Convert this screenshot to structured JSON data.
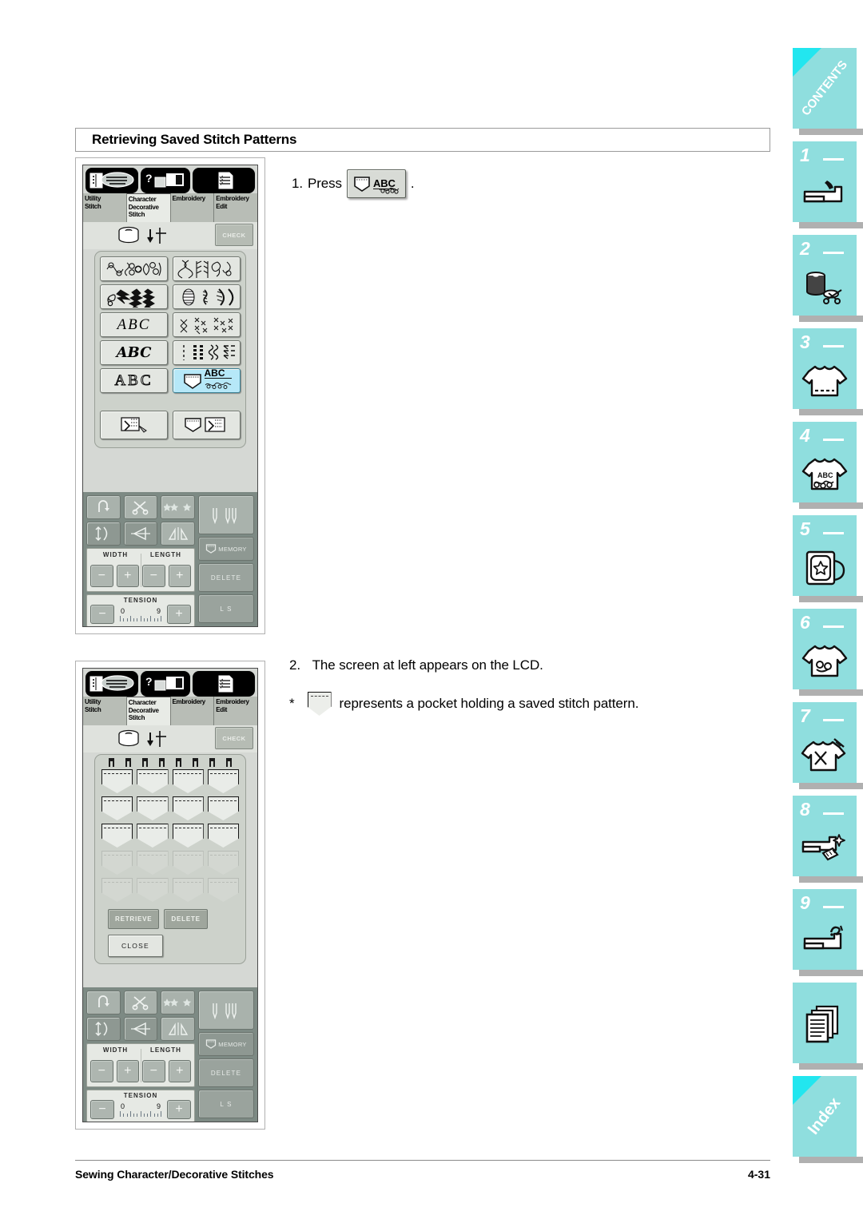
{
  "heading": {
    "title": "Retrieving Saved Stitch Patterns"
  },
  "steps": {
    "step1_number": "1.",
    "step1_text": "Press",
    "step1_button_label": "ABC",
    "step1_period": ".",
    "step2_number": "2.",
    "step2_text": "The screen at left appears on the LCD.",
    "note_marker": "*",
    "note_text": "represents a pocket holding a saved stitch pattern."
  },
  "lcd": {
    "tabs": [
      {
        "label_line1": "Utility",
        "label_line2": "Stitch",
        "label_line3": "",
        "active": false
      },
      {
        "label_line1": "Character",
        "label_line2": "Decorative",
        "label_line3": "Stitch",
        "active": true
      },
      {
        "label_line1": "Embroidery",
        "label_line2": "",
        "label_line3": "",
        "active": false
      },
      {
        "label_line1": "Embroidery",
        "label_line2": "Edit",
        "label_line3": "",
        "active": false
      }
    ],
    "top_icons": [
      "notebook-stitch-icon",
      "question-machine-icon",
      "checklist-page-icon"
    ],
    "check_label": "CHECK",
    "spool_icon": "thread-spool-icon",
    "needle_icon": "needle-down-icon",
    "pattern_buttons": [
      {
        "name": "ornamental-stitch-group",
        "kind": "glyph",
        "selected": false
      },
      {
        "name": "cross-stitch-group",
        "kind": "glyph",
        "selected": false
      },
      {
        "name": "satin-stitch-group",
        "kind": "glyph",
        "selected": false
      },
      {
        "name": "leaf-stitch-group",
        "kind": "glyph",
        "selected": false
      },
      {
        "name": "abc-sans-italic",
        "kind": "text",
        "text": "ABC",
        "style": "serif-italic",
        "selected": false
      },
      {
        "name": "cross-decorative-group",
        "kind": "glyph",
        "selected": false
      },
      {
        "name": "abc-script",
        "kind": "text",
        "text": "ABC",
        "style": "script",
        "selected": false
      },
      {
        "name": "utility-stitch-group",
        "kind": "glyph",
        "selected": false
      },
      {
        "name": "abc-outline",
        "kind": "text",
        "text": "ABC",
        "style": "outline",
        "selected": false
      },
      {
        "name": "saved-pocket-abc",
        "kind": "pocket-abc",
        "text": "ABC",
        "selected": true
      }
    ],
    "bottom_pattern_buttons": [
      {
        "name": "my-custom-stitch-button"
      },
      {
        "name": "pocket-memory-button"
      }
    ],
    "controls": {
      "row1": [
        "reverse-stitch-icon",
        "thread-cutter-icon",
        "auto-stitch-icon",
        "single-needle-icon"
      ],
      "row2": [
        "stitch-length-icon",
        "mirror-horizontal-icon",
        "mirror-vertical-icon",
        "memory-button"
      ],
      "memory_label": "MEMORY",
      "width_label": "WIDTH",
      "length_label": "LENGTH",
      "tension_label": "TENSION",
      "tension_min": "0",
      "tension_max": "9",
      "minus": "−",
      "plus": "+",
      "delete_label": "DELETE",
      "ls_label": "L    S"
    }
  },
  "pocket_screen": {
    "clip_count": 8,
    "rows": [
      {
        "enabled": true,
        "cells": 4
      },
      {
        "enabled": true,
        "cells": 4
      },
      {
        "enabled": true,
        "cells": 4
      },
      {
        "enabled": false,
        "cells": 4
      },
      {
        "enabled": false,
        "cells": 4
      }
    ],
    "retrieve_label": "RETRIEVE",
    "delete_label": "DELETE",
    "close_label": "CLOSE"
  },
  "sidebar": {
    "tabs": [
      {
        "id": "contents",
        "type": "label",
        "label": "CONTENTS",
        "number": "",
        "icon": ""
      },
      {
        "id": "ch1",
        "type": "numbered",
        "label": "",
        "number": "1",
        "icon": "sewing-machine-icon"
      },
      {
        "id": "ch2",
        "type": "numbered",
        "label": "",
        "number": "2",
        "icon": "spool-bobbin-scissors-icon"
      },
      {
        "id": "ch3",
        "type": "numbered",
        "label": "",
        "number": "3",
        "icon": "tshirt-hem-icon"
      },
      {
        "id": "ch4",
        "type": "numbered",
        "label": "",
        "number": "4",
        "icon": "tshirt-abc-icon"
      },
      {
        "id": "ch5",
        "type": "numbered",
        "label": "",
        "number": "5",
        "icon": "embroidery-hoop-star-icon"
      },
      {
        "id": "ch6",
        "type": "numbered",
        "label": "",
        "number": "6",
        "icon": "tshirt-embroidery-icon"
      },
      {
        "id": "ch7",
        "type": "numbered",
        "label": "",
        "number": "7",
        "icon": "tshirt-needle-icon"
      },
      {
        "id": "ch8",
        "type": "numbered",
        "label": "",
        "number": "8",
        "icon": "machine-cleaning-icon"
      },
      {
        "id": "ch9",
        "type": "numbered",
        "label": "",
        "number": "9",
        "icon": "machine-question-icon"
      },
      {
        "id": "appendix",
        "type": "icononly",
        "label": "",
        "number": "",
        "icon": "stacked-pages-icon"
      },
      {
        "id": "index",
        "type": "label",
        "label": "Index",
        "number": "",
        "icon": ""
      }
    ],
    "tab_color": "#8fdede",
    "corner_color": "#22e6ef",
    "shadow_color": "#b0b0b0"
  },
  "footer": {
    "chapter_title": "Sewing Character/Decorative Stitches",
    "page_number": "4-31"
  }
}
